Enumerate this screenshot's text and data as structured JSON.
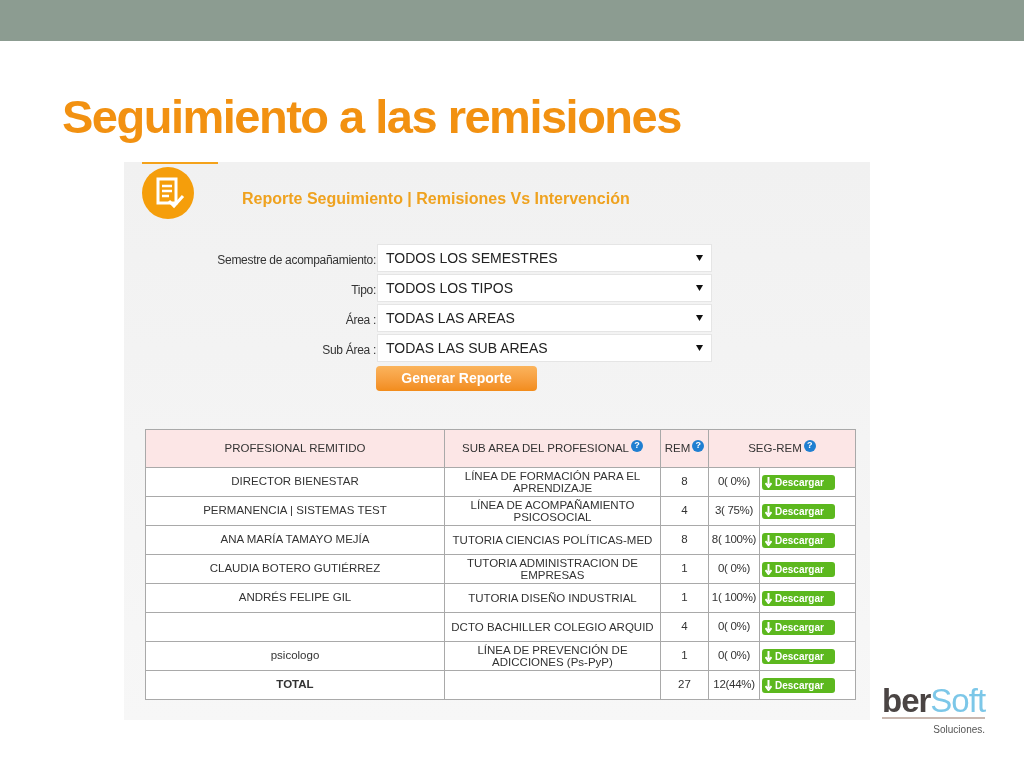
{
  "slide": {
    "title": "Seguimiento a las remisiones"
  },
  "panel": {
    "title": "Reporte Seguimiento | Remisiones Vs Intervención",
    "filters": [
      {
        "label": "Semestre de acompañamiento:",
        "value": "TODOS LOS SEMESTRES"
      },
      {
        "label": "Tipo:",
        "value": "TODOS LOS TIPOS"
      },
      {
        "label": "Área :",
        "value": "TODAS LAS AREAS"
      },
      {
        "label": "Sub Área :",
        "value": "TODAS LAS SUB AREAS"
      }
    ],
    "button": "Generar Reporte"
  },
  "table": {
    "columns": [
      {
        "label": "PROFESIONAL REMITIDO"
      },
      {
        "label": "SUB AREA DEL PROFESIONAL",
        "help": "?"
      },
      {
        "label": "REM",
        "help": "?"
      },
      {
        "label": "SEG-REM",
        "help": "?"
      }
    ],
    "rows": [
      {
        "professional": "DIRECTOR BIENESTAR",
        "sub_area": "LÍNEA DE FORMACIÓN PARA EL APRENDIZAJE",
        "rem": "8",
        "seg_rem": "0( 0%)",
        "action": "Descargar"
      },
      {
        "professional": "PERMANENCIA | SISTEMAS TEST",
        "sub_area": "LÍNEA DE ACOMPAÑAMIENTO PSICOSOCIAL",
        "rem": "4",
        "seg_rem": "3( 75%)",
        "action": "Descargar"
      },
      {
        "professional": "ANA MARÍA TAMAYO MEJÍA",
        "sub_area": "TUTORIA CIENCIAS POLÍTICAS-MED",
        "rem": "8",
        "seg_rem": "8( 100%)",
        "action": "Descargar"
      },
      {
        "professional": "CLAUDIA BOTERO GUTIÉRREZ",
        "sub_area": "TUTORIA ADMINISTRACION DE EMPRESAS",
        "rem": "1",
        "seg_rem": "0( 0%)",
        "action": "Descargar"
      },
      {
        "professional": "ANDRÉS FELIPE GIL",
        "sub_area": "TUTORIA DISEÑO INDUSTRIAL",
        "rem": "1",
        "seg_rem": "1( 100%)",
        "action": "Descargar"
      },
      {
        "sub_area": "DCTO BACHILLER COLEGIO ARQUID",
        "rem": "4",
        "seg_rem": "0( 0%)",
        "action": "Descargar"
      },
      {
        "professional": "psicologo",
        "sub_area": "LÍNEA DE PREVENCIÓN DE ADICCIONES (Ps-PyP)",
        "rem": "1",
        "seg_rem": "0( 0%)",
        "action": "Descargar"
      }
    ],
    "total_row": {
      "label": "TOTAL",
      "rem": "27",
      "seg_rem": "12(44%)",
      "action": "Descargar"
    }
  },
  "logo": {
    "part1": "ber",
    "part2": "Soft",
    "tagline": "Soluciones."
  }
}
